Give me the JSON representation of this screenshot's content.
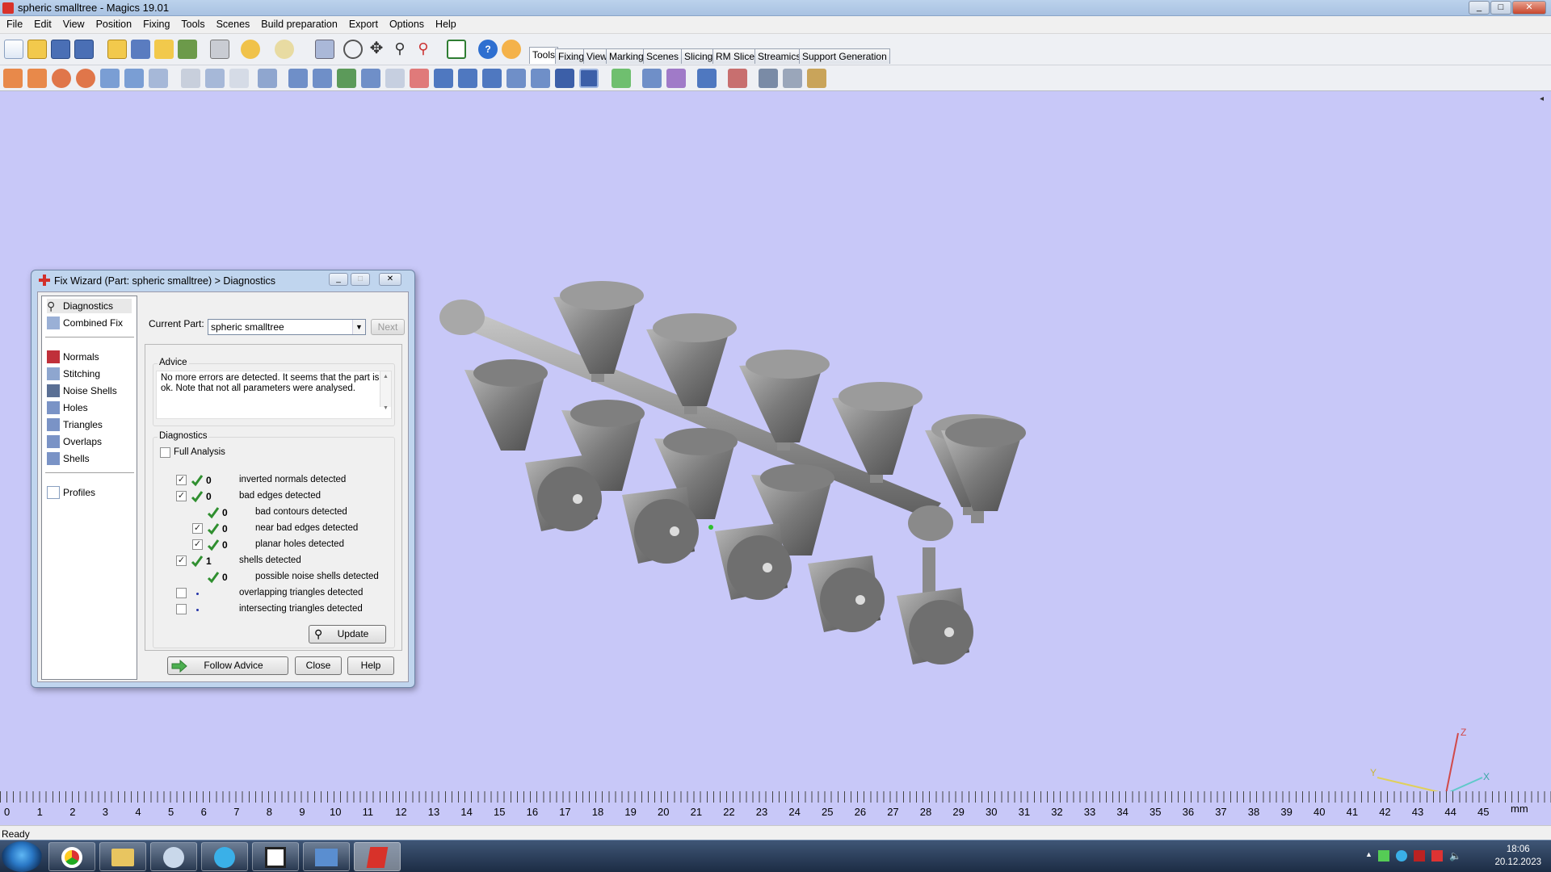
{
  "window": {
    "title": "spheric smalltree - Magics 19.01"
  },
  "menu": [
    "File",
    "Edit",
    "View",
    "Position",
    "Fixing",
    "Tools",
    "Scenes",
    "Build preparation",
    "Export",
    "Options",
    "Help"
  ],
  "tabs": [
    "Tools",
    "Fixing",
    "View",
    "Marking",
    "Scenes",
    "Slicing",
    "RM Slicer",
    "Streamics",
    "Support Generation"
  ],
  "active_tab": "Tools",
  "dialog": {
    "title": "Fix Wizard (Part: spheric smalltree) > Diagnostics",
    "nav_top": [
      "Diagnostics",
      "Combined Fix"
    ],
    "nav_mid": [
      "Normals",
      "Stitching",
      "Noise Shells",
      "Holes",
      "Triangles",
      "Overlaps",
      "Shells"
    ],
    "nav_bottom": [
      "Profiles"
    ],
    "current_part_label": "Current Part:",
    "current_part_value": "spheric smalltree",
    "next_label": "Next",
    "advice_label": "Advice",
    "advice_text": "No more errors are detected. It seems that the part is ok. Note that not all parameters were analysed.",
    "diagnostics_label": "Diagnostics",
    "full_analysis_label": "Full Analysis",
    "rows": [
      {
        "count": "0",
        "text": "inverted normals detected"
      },
      {
        "count": "0",
        "text": "bad edges detected"
      },
      {
        "count": "0",
        "text": "bad contours detected"
      },
      {
        "count": "0",
        "text": "near bad edges detected"
      },
      {
        "count": "0",
        "text": "planar holes detected"
      },
      {
        "count": "1",
        "text": "shells detected"
      },
      {
        "count": "0",
        "text": "possible noise shells detected"
      },
      {
        "count": "",
        "text": "overlapping triangles detected"
      },
      {
        "count": "",
        "text": "intersecting triangles detected"
      }
    ],
    "update_label": "Update",
    "follow_advice_label": "Follow Advice",
    "close_label": "Close",
    "help_label": "Help"
  },
  "ruler": {
    "labels": [
      "0",
      "1",
      "2",
      "3",
      "4",
      "5",
      "6",
      "7",
      "8",
      "9",
      "10",
      "11",
      "12",
      "13",
      "14",
      "15",
      "16",
      "17",
      "18",
      "19",
      "20",
      "21",
      "22",
      "23",
      "24",
      "25",
      "26",
      "27",
      "28",
      "29",
      "30",
      "31",
      "32",
      "33",
      "34",
      "35",
      "36",
      "37",
      "38",
      "39",
      "40",
      "41",
      "42",
      "43",
      "44",
      "45"
    ],
    "unit": "mm"
  },
  "axis_labels": {
    "z": "Z",
    "x": "X",
    "y": "Y"
  },
  "status": {
    "text": "Ready"
  },
  "taskbar": {
    "time": "18:06",
    "date": "20.12.2023"
  },
  "colors": {
    "viewport": "#c8c8f8",
    "model": "#7a7a7a",
    "check": "#2f8f2f"
  }
}
